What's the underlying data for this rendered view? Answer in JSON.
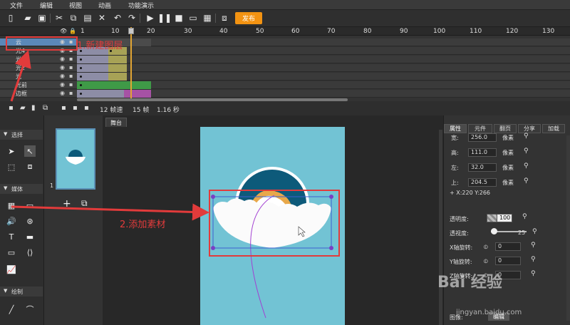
{
  "menu": [
    "文件",
    "编辑",
    "视图",
    "动画",
    "功能演示"
  ],
  "toolbar": {
    "publish_label": "发布"
  },
  "timeline": {
    "ruler": [
      "1",
      "10",
      "20",
      "30",
      "40",
      "50",
      "60",
      "70",
      "80",
      "90",
      "100",
      "110",
      "120",
      "130"
    ],
    "layers": [
      {
        "name": "云",
        "selected": true
      },
      {
        "name": "光4",
        "selected": false
      },
      {
        "name": "光3",
        "selected": false
      },
      {
        "name": "光2",
        "selected": false
      },
      {
        "name": "光",
        "selected": false
      },
      {
        "name": "光前",
        "selected": false
      },
      {
        "name": "边框",
        "selected": false
      }
    ],
    "fps": "12 帧速",
    "frames": "15 帧",
    "seconds": "1.16 秒"
  },
  "left_panel": {
    "sections": [
      "选择",
      "媒体",
      "绘制"
    ]
  },
  "scenes": {
    "number": "1"
  },
  "stage": {
    "tab_label": "舞台"
  },
  "properties": {
    "tabs": [
      "属性",
      "元件",
      "翻页",
      "分享",
      "加载"
    ],
    "width_label": "宽:",
    "width_value": "256.0",
    "height_label": "高:",
    "height_value": "111.0",
    "left_label": "左:",
    "left_value": "32.0",
    "top_label": "上:",
    "top_value": "204.5",
    "unit": "像素",
    "coords": "+ X:220   Y:266",
    "opacity_label": "透明度:",
    "opacity_value": "100",
    "perspective_label": "透视度:",
    "perspective_value": "25",
    "xrot_label": "X轴旋转:",
    "xrot_value": "0",
    "yrot_label": "Y轴旋转:",
    "yrot_value": "0",
    "zrot_label": "Z轴旋转:",
    "zrot_value": "0",
    "image_label": "图像:",
    "edit_label": "编辑"
  },
  "annotations": {
    "step1": "1.新建图层",
    "step2": "2.添加素材"
  },
  "watermark": {
    "main": "Bai 经验",
    "sub": "jingyan.baidu.com"
  },
  "colors": {
    "accent": "#f39312",
    "annotation": "#e23b3b",
    "stage": "#72c3d4",
    "selection": "#5b88b8"
  }
}
